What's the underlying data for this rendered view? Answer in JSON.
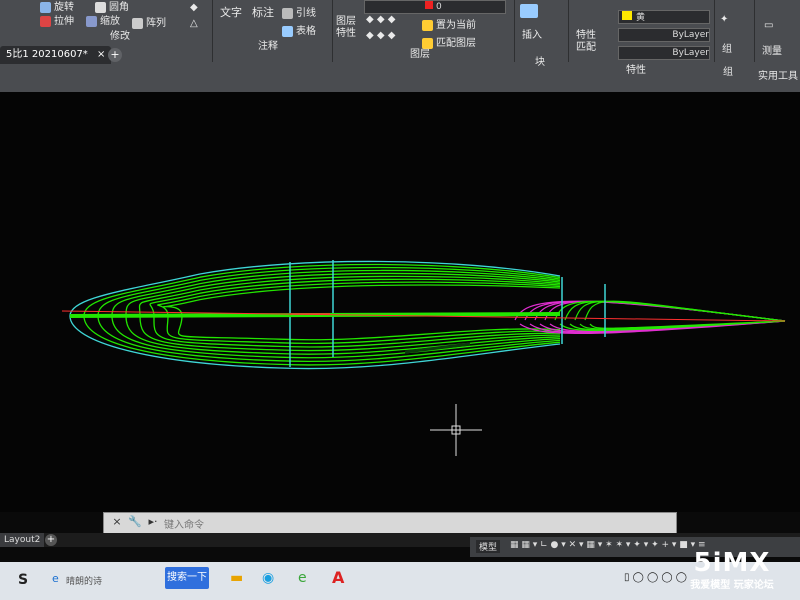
{
  "ribbon": {
    "modify": {
      "stretch": "拉伸",
      "scale": "缩放",
      "array": "阵列",
      "title": "修改",
      "rounded": "圆角",
      "rotate": "旋转"
    },
    "annotation": {
      "text": "文字",
      "dimension": "标注",
      "leader": "引线",
      "table": "表格",
      "title": "注释"
    },
    "layers": {
      "props": "图层\n特性",
      "set_current": "置为当前",
      "match_layer": "匹配图层",
      "title": "图层",
      "layer_value": "0"
    },
    "block": {
      "insert": "插入",
      "title": "块"
    },
    "properties": {
      "match": "特性\n匹配",
      "color": "黄",
      "linetype": "ByLayer",
      "lineweight": "ByLayer",
      "title": "特性"
    },
    "groups": {
      "group": "组",
      "title": "组"
    },
    "utilities": {
      "measure": "测量",
      "title": "实用工具"
    }
  },
  "file_tab": {
    "label": "5比1 20210607*",
    "close": "×",
    "plus": "+"
  },
  "command": {
    "placeholder": "键入命令",
    "close": "×",
    "wrench": "🔧",
    "arrow": "▸·"
  },
  "layout_tabs": {
    "layout2": "Layout2",
    "plus": "+"
  },
  "statusbar": {
    "model": "模型"
  },
  "taskbar": {
    "start": "S",
    "edge_label": "晴朗的诗",
    "search": "搜索一下"
  },
  "watermark": {
    "brand": "5iMX",
    "slogan": "我爱模型 玩家论坛"
  },
  "colors": {
    "green": "#22e600",
    "cyan": "#3fd6d6",
    "magenta": "#e02ed0",
    "red": "#ff3030"
  }
}
